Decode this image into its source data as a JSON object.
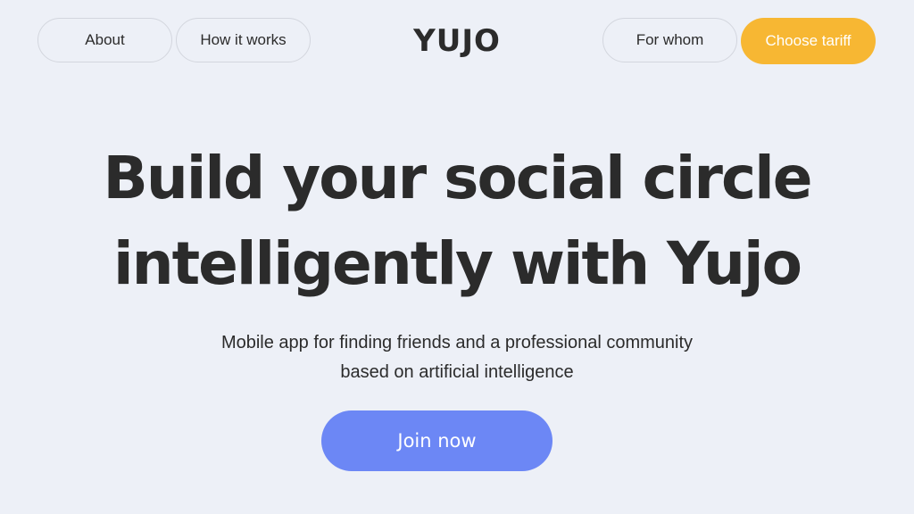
{
  "header": {
    "nav_left": [
      {
        "label": "About"
      },
      {
        "label": "How it works"
      }
    ],
    "logo": "YUJO",
    "nav_right": [
      {
        "label": "For whom"
      }
    ],
    "cta_label": "Choose tariff"
  },
  "hero": {
    "headline_line1": "Build your social circle",
    "headline_line2": "intelligently with Yujo",
    "subtitle_line1": "Mobile app for finding friends and a professional community",
    "subtitle_line2": "based on artificial intelligence",
    "button_label": "Join now"
  },
  "colors": {
    "background": "#edf0f7",
    "text": "#2b2b2b",
    "tariff_button": "#f7b733",
    "join_button": "#6c87f5",
    "pill_border": "#d3d6de"
  }
}
